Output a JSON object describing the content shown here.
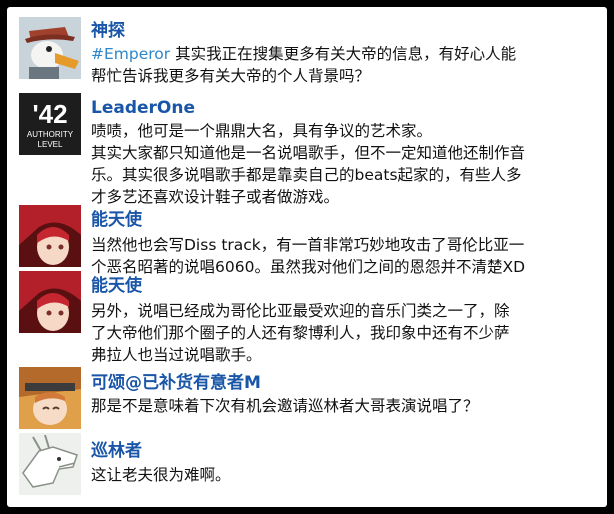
{
  "messages": [
    {
      "avatar_icon": "goose-detective-avatar-icon",
      "name": "神探",
      "mention": "#Emperor",
      "lines": [
        "其实我正在搜集更多有关大帝的信息，有好心人能",
        "帮忙告诉我更多有关大帝的个人背景吗？"
      ]
    },
    {
      "avatar_icon": "authority-level-42-badge-icon",
      "avatar_text": {
        "number": "'42",
        "line1": "AUTHORITY",
        "line2": "LEVEL"
      },
      "name": "LeaderOne",
      "lines": [
        "啧啧，他可是一个鼎鼎大名，具有争议的艺术家。",
        "其实大家都只知道他是一名说唱歌手，但不一定知道他还制作音",
        "乐。其实很多说唱歌手都是靠卖自己的beats起家的，有些人多",
        "才多艺还喜欢设计鞋子或者做游戏。"
      ]
    },
    {
      "avatar_icon": "exusiai-avatar-icon",
      "name": "能天使",
      "lines": [
        "当然他也会写Diss track，有一首非常巧妙地攻击了哥伦比亚一",
        "个恶名昭著的说唱6060。虽然我对他们之间的恩怨并不清楚XD"
      ]
    },
    {
      "avatar_icon": "exusiai-avatar-icon",
      "name": "能天使",
      "lines": [
        "另外，说唱已经成为哥伦比亚最受欢迎的音乐门类之一了，除",
        "了大帝他们那个圈子的人还有黎博利人，我印象中还有不少萨",
        "弗拉人也当过说唱歌手。"
      ]
    },
    {
      "avatar_icon": "kejuan-avatar-icon",
      "name": "可颂@已补货有意者M",
      "lines": [
        "那是不是意味着下次有机会邀请巡林者大哥表演说唱了？"
      ]
    },
    {
      "avatar_icon": "ranger-white-dragon-avatar-icon",
      "name": "巡林者",
      "lines": [
        "这让老夫很为难啊。"
      ]
    }
  ],
  "colors": {
    "name": "#1a56a8",
    "mention": "#2f86c8",
    "text": "#111111",
    "frame": "#000000"
  }
}
